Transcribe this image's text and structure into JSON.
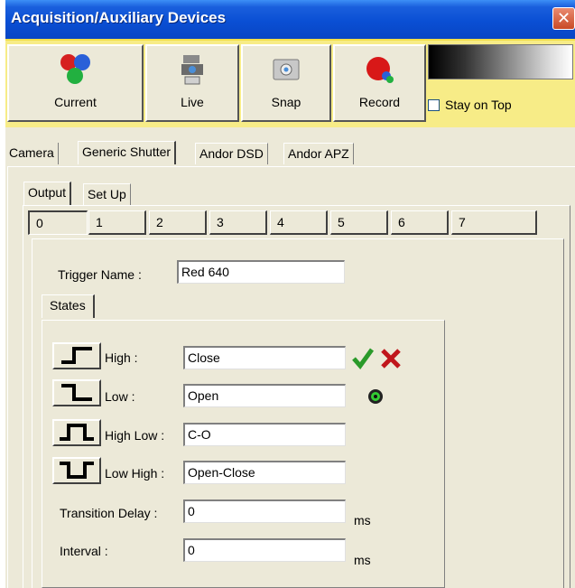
{
  "window": {
    "title": "Acquisition/Auxiliary Devices",
    "close_glyph": "✕"
  },
  "toolbar": {
    "buttons": [
      {
        "label": "Current",
        "icon": "current-icon"
      },
      {
        "label": "Live",
        "icon": "live-camera-icon"
      },
      {
        "label": "Snap",
        "icon": "snap-camera-icon"
      },
      {
        "label": "Record",
        "icon": "record-icon"
      }
    ],
    "stay_on_top": {
      "label": "Stay on Top",
      "checked": false
    }
  },
  "device_tabs": [
    "Camera",
    "Generic Shutter",
    "Andor DSD",
    "Andor APZ"
  ],
  "device_tab_active": "Generic Shutter",
  "sub_tabs": [
    "Output",
    "Set Up"
  ],
  "sub_tab_active": "Output",
  "channels": [
    "0",
    "1",
    "2",
    "3",
    "4",
    "5",
    "6",
    "7"
  ],
  "channel_active": "0",
  "trigger": {
    "label": "Trigger Name :",
    "value": "Red 640"
  },
  "states_tab": "States",
  "states": [
    {
      "label": "High :",
      "value": "Close",
      "signal": "rising-edge-icon"
    },
    {
      "label": "Low :",
      "value": "Open",
      "signal": "falling-edge-icon"
    },
    {
      "label": "High Low :",
      "value": "C-O",
      "signal": "pulse-high-icon"
    },
    {
      "label": "Low High :",
      "value": "Open-Close",
      "signal": "pulse-low-icon"
    }
  ],
  "transition_delay": {
    "label": "Transition Delay :",
    "value": "0",
    "unit": "ms"
  },
  "interval": {
    "label": "Interval :",
    "value": "0",
    "unit": "ms"
  },
  "colors": {
    "title_bar": "#0a4fd4",
    "toolbar_bg": "#f7ec87",
    "dialog_bg": "#ece9d8",
    "accept": "#2a9a2a",
    "reject": "#c0161c"
  }
}
